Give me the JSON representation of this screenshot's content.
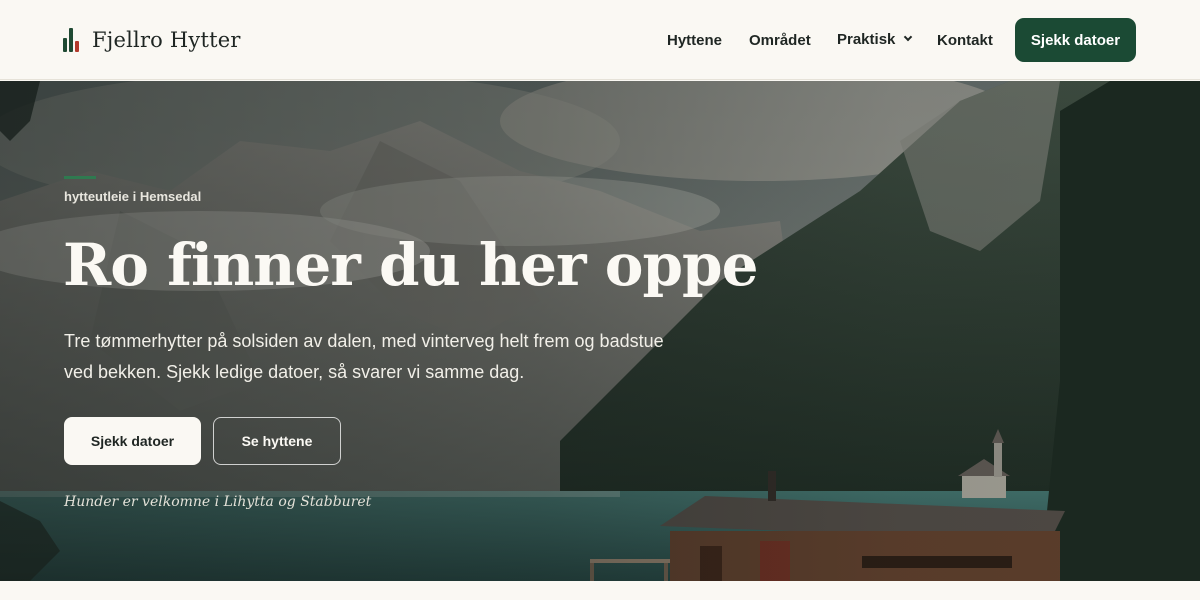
{
  "brand": {
    "name": "Fjellro Hytter",
    "icon": "bar-chart-logo-icon",
    "colors": {
      "green": "#1b4a34",
      "red": "#b23a2c"
    }
  },
  "nav": {
    "items": [
      {
        "label": "Hyttene"
      },
      {
        "label": "Området"
      },
      {
        "label": "Praktisk",
        "has_dropdown": true
      },
      {
        "label": "Kontakt"
      }
    ],
    "cta": "Sjekk datoer"
  },
  "hero": {
    "eyebrow": "hytteutleie i Hemsedal",
    "title": "Ro finner du her oppe",
    "lead": "Tre tømmerhytter på solsiden av dalen, med vinterveg helt frem og badstue ved bekken. Sjekk ledige datoer, så svarer vi samme dag.",
    "primary_button": "Sjekk datoer",
    "secondary_button": "Se hyttene",
    "note": "Hunder er velkomne i Lihytta og Stabburet",
    "background": "mountain-lake-cabin-photo"
  },
  "colors": {
    "accent": "#1b4a34",
    "page_bg": "#faf8f3",
    "text": "#1f2623",
    "eyebrow_line": "#2f7a50"
  }
}
